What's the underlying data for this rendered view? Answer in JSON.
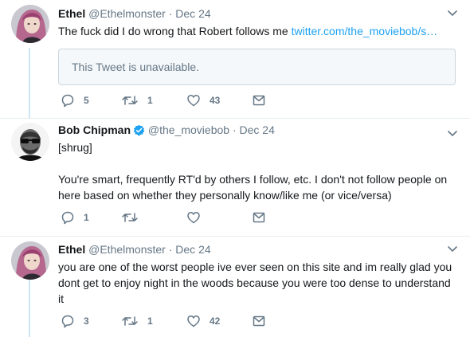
{
  "tweets": [
    {
      "name": "Ethel",
      "handle": "@Ethelmonster",
      "sep": "·",
      "date": "Dec 24",
      "text": "The fuck did I do wrong that Robert follows me ",
      "link": "twitter.com/the_moviebob/s…",
      "quoted": "This Tweet is unavailable.",
      "reply_count": "5",
      "retweet_count": "1",
      "like_count": "43"
    },
    {
      "name": "Bob Chipman",
      "handle": "@the_moviebob",
      "sep": "·",
      "date": "Dec 24",
      "verified": true,
      "text_line1": "[shrug]",
      "text_para": "You're smart, frequently RT'd by others I follow, etc. I don't not follow people on here based on whether they personally know/like me (or vice/versa)",
      "reply_count": "1",
      "retweet_count": "",
      "like_count": ""
    },
    {
      "name": "Ethel",
      "handle": "@Ethelmonster",
      "sep": "·",
      "date": "Dec 24",
      "text": "you are one of the worst people ive ever seen on this site and im really glad you dont get to enjoy night in the woods because you were too dense to understand it",
      "reply_count": "3",
      "retweet_count": "1",
      "like_count": "42"
    }
  ],
  "colors": {
    "text": "#14171a",
    "secondary": "#657786",
    "link": "#1da1f2",
    "verified": "#1da1f2",
    "thread_line": "#cce6f4",
    "divider": "#e6ecf0"
  },
  "icons": [
    "reply-icon",
    "retweet-icon",
    "like-icon",
    "dm-icon",
    "caret-down-icon",
    "verified-badge-icon"
  ]
}
